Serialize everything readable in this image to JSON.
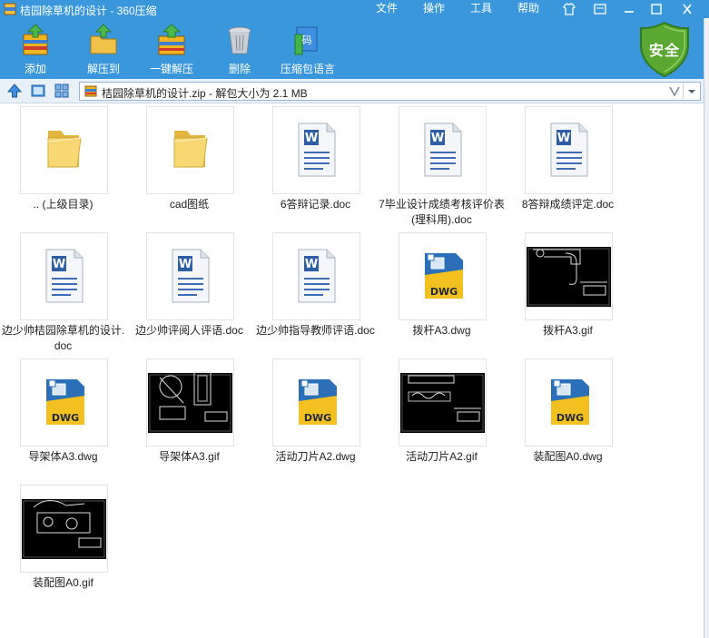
{
  "window": {
    "title": "桔园除草机的设计 - 360压缩",
    "menu": [
      "文件",
      "操作",
      "工具",
      "帮助"
    ]
  },
  "toolbar": {
    "buttons": [
      {
        "label": "添加",
        "icon": "add-archive-icon"
      },
      {
        "label": "解压到",
        "icon": "extract-to-icon"
      },
      {
        "label": "一键解压",
        "icon": "one-click-extract-icon"
      },
      {
        "label": "删除",
        "icon": "delete-icon"
      },
      {
        "label": "压缩包语言",
        "icon": "archive-language-icon"
      }
    ],
    "security_badge": "安全"
  },
  "address": {
    "path": "桔园除草机的设计.zip - 解包大小为 2.1 MB"
  },
  "files": [
    {
      "name": ".. (上级目录)",
      "kind": "folder"
    },
    {
      "name": "cad图纸",
      "kind": "folder"
    },
    {
      "name": "6答辩记录.doc",
      "kind": "doc"
    },
    {
      "name": "7毕业设计成绩考核评价表(理科用).doc",
      "kind": "doc"
    },
    {
      "name": "8答辩成绩评定.doc",
      "kind": "doc"
    },
    {
      "name": "边少帅桔园除草机的设计.doc",
      "kind": "doc"
    },
    {
      "name": "边少帅评阅人评语.doc",
      "kind": "doc"
    },
    {
      "name": "边少帅指导教师评语.doc",
      "kind": "doc"
    },
    {
      "name": "拨杆A3.dwg",
      "kind": "dwg"
    },
    {
      "name": "拨杆A3.gif",
      "kind": "gif"
    },
    {
      "name": "导架体A3.dwg",
      "kind": "dwg"
    },
    {
      "name": "导架体A3.gif",
      "kind": "gif"
    },
    {
      "name": "活动刀片A2.dwg",
      "kind": "dwg"
    },
    {
      "name": "活动刀片A2.gif",
      "kind": "gif"
    },
    {
      "name": "装配图A0.dwg",
      "kind": "dwg"
    },
    {
      "name": "装配图A0.gif",
      "kind": "gif"
    }
  ],
  "colors": {
    "titlebar": "#3a97dc",
    "shield": "#5aa832"
  }
}
